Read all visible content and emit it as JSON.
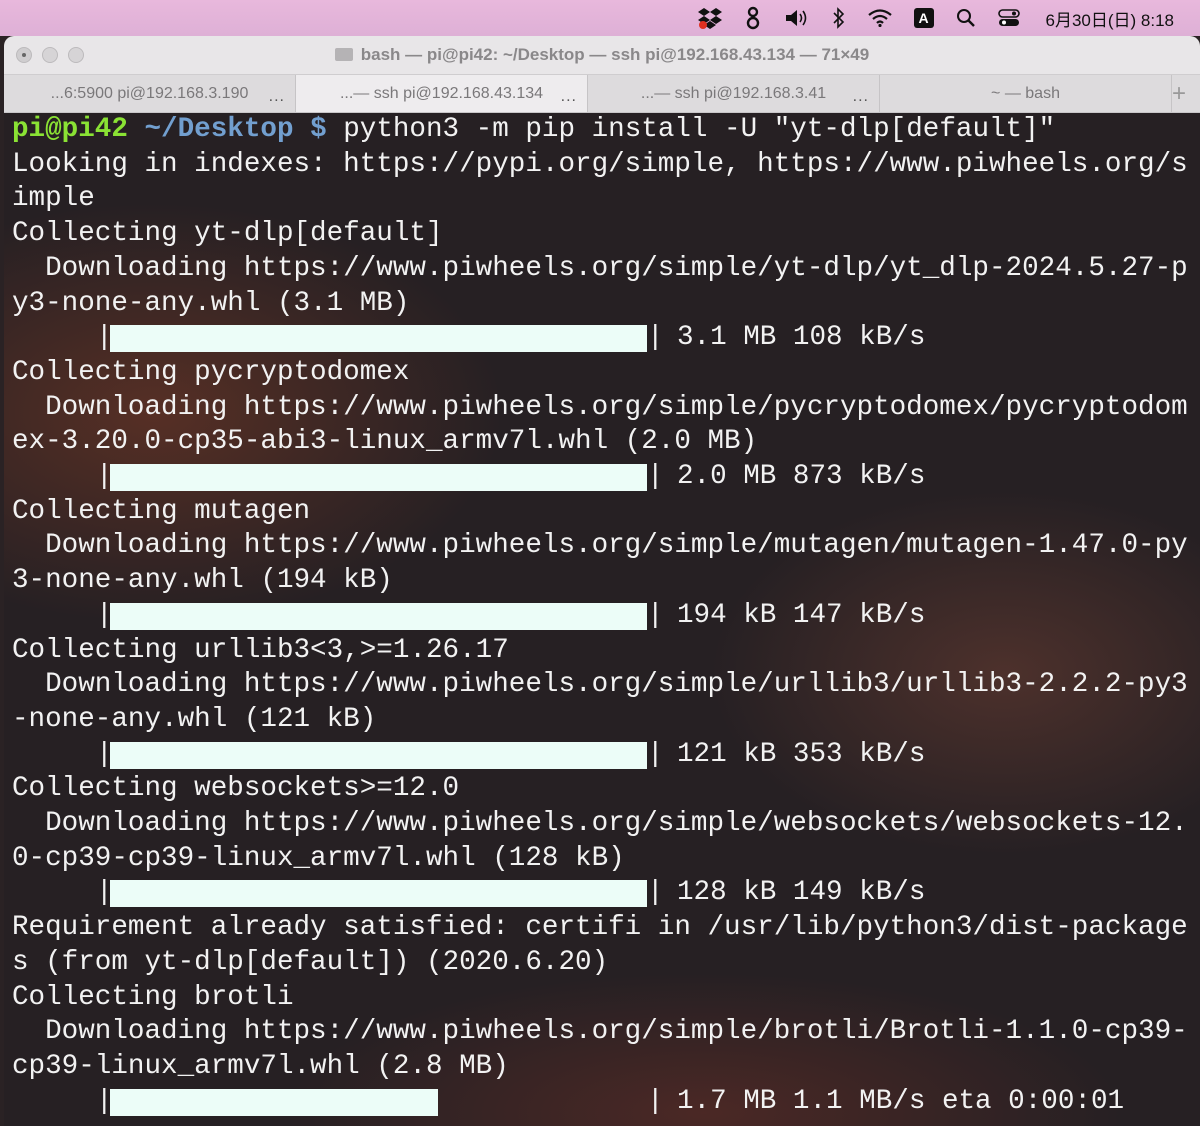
{
  "menubar": {
    "ab_label": "A",
    "clock": "6月30日(日) 8:18"
  },
  "window": {
    "title": "bash — pi@pi42: ~/Desktop — ssh pi@192.168.43.134 — 71×49"
  },
  "tabs": [
    {
      "label": "...6:5900 pi@192.168.3.190",
      "dots": "..."
    },
    {
      "label": "...— ssh pi@192.168.43.134",
      "dots": "..."
    },
    {
      "label": "...— ssh pi@192.168.3.41",
      "dots": "..."
    },
    {
      "label": "~ — bash",
      "dots": ""
    }
  ],
  "new_tab": "+",
  "prompt": {
    "user": "pi@pi42",
    "path": "~/Desktop",
    "sigil": "$",
    "command": " python3 -m pip install -U \"yt-dlp[default]\""
  },
  "output_lines": [
    "Looking in indexes: https://pypi.org/simple, https://www.piwheels.org/s",
    "imple",
    "Collecting yt-dlp[default]",
    "  Downloading https://www.piwheels.org/simple/yt-dlp/yt_dlp-2024.5.27-p",
    "y3-none-any.whl (3.1 MB)",
    "",
    "Collecting pycryptodomex",
    "  Downloading https://www.piwheels.org/simple/pycryptodomex/pycryptodom",
    "ex-3.20.0-cp35-abi3-linux_armv7l.whl (2.0 MB)",
    "",
    "Collecting mutagen",
    "  Downloading https://www.piwheels.org/simple/mutagen/mutagen-1.47.0-py",
    "3-none-any.whl (194 kB)",
    "",
    "Collecting urllib3<3,>=1.26.17",
    "  Downloading https://www.piwheels.org/simple/urllib3/urllib3-2.2.2-py3",
    "-none-any.whl (121 kB)",
    "",
    "Collecting websockets>=12.0",
    "  Downloading https://www.piwheels.org/simple/websockets/websockets-12.",
    "0-cp39-cp39-linux_armv7l.whl (128 kB)",
    "",
    "Requirement already satisfied: certifi in /usr/lib/python3/dist-package",
    "s (from yt-dlp[default]) (2020.6.20)",
    "Collecting brotli",
    "  Downloading https://www.piwheels.org/simple/brotli/Brotli-1.1.0-cp39-",
    "cp39-linux_armv7l.whl (2.8 MB)",
    ""
  ],
  "progress": [
    {
      "fraction": 1.0,
      "stats": "3.1 MB 108 kB/s"
    },
    {
      "fraction": 1.0,
      "stats": "2.0 MB 873 kB/s"
    },
    {
      "fraction": 1.0,
      "stats": "194 kB 147 kB/s"
    },
    {
      "fraction": 1.0,
      "stats": "121 kB 353 kB/s"
    },
    {
      "fraction": 1.0,
      "stats": "128 kB 149 kB/s"
    },
    {
      "fraction": 0.61,
      "stats": "1.7 MB 1.1 MB/s eta 0:00:01"
    }
  ],
  "colors": {
    "bar_fill": "#ecfdf8",
    "prompt_user": "#8ae234",
    "prompt_path": "#729fcf"
  }
}
